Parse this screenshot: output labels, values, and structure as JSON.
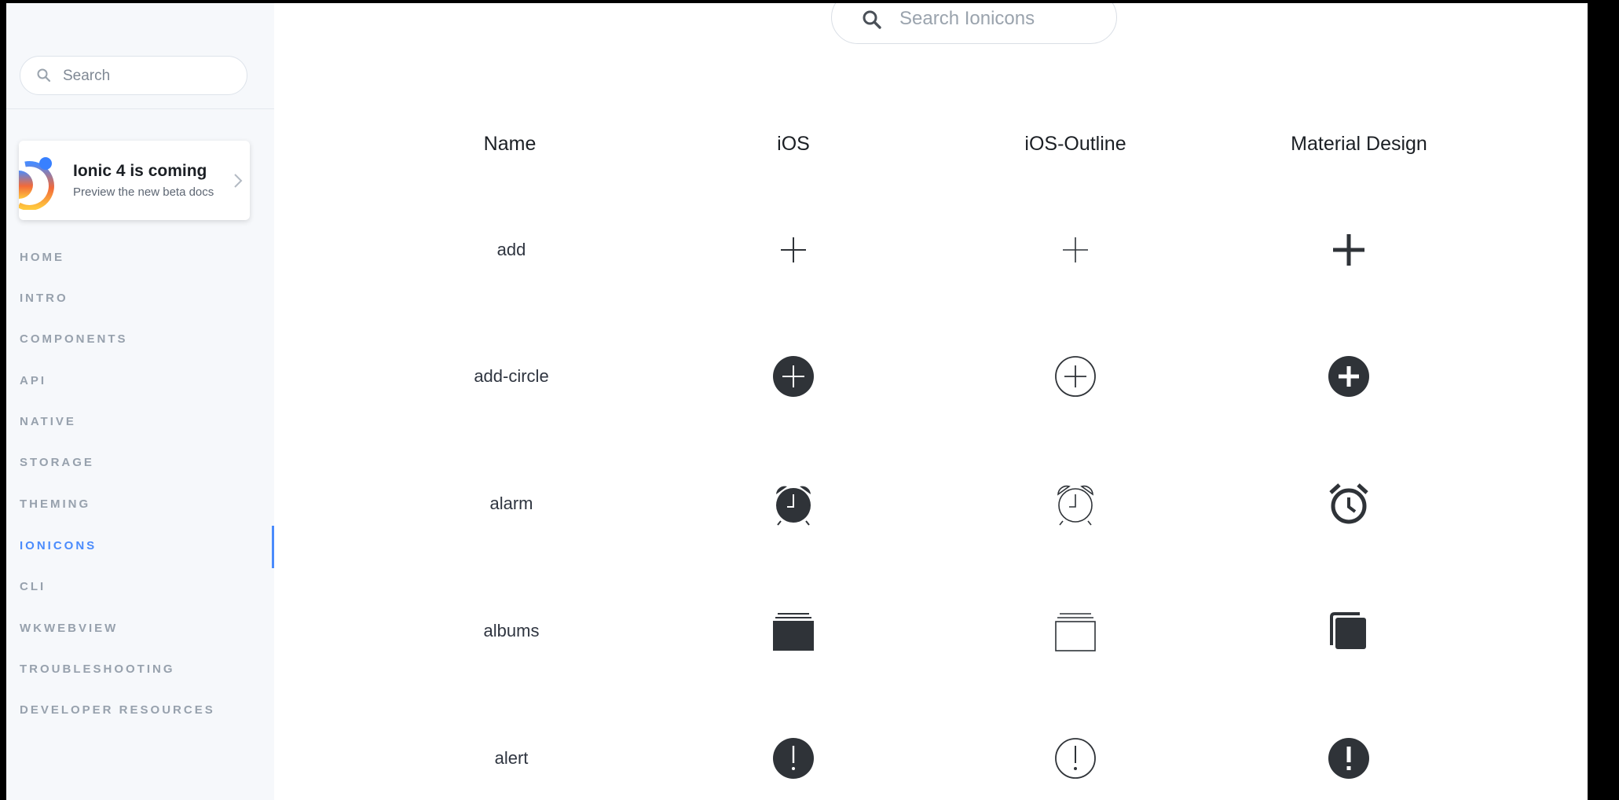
{
  "sidebar": {
    "search_placeholder": "Search",
    "promo": {
      "title": "Ionic 4 is coming",
      "subtitle": "Preview the new beta docs"
    },
    "nav": [
      {
        "label": "HOME",
        "active": false
      },
      {
        "label": "INTRO",
        "active": false
      },
      {
        "label": "COMPONENTS",
        "active": false
      },
      {
        "label": "API",
        "active": false
      },
      {
        "label": "NATIVE",
        "active": false
      },
      {
        "label": "STORAGE",
        "active": false
      },
      {
        "label": "THEMING",
        "active": false
      },
      {
        "label": "IONICONS",
        "active": true
      },
      {
        "label": "CLI",
        "active": false
      },
      {
        "label": "WKWEBVIEW",
        "active": false
      },
      {
        "label": "TROUBLESHOOTING",
        "active": false
      },
      {
        "label": "DEVELOPER RESOURCES",
        "active": false
      }
    ],
    "active_color": "#4a8bfc"
  },
  "main": {
    "search_placeholder": "Search Ionicons",
    "columns": [
      "Name",
      "iOS",
      "iOS-Outline",
      "Material Design"
    ],
    "rows": [
      {
        "name": "add",
        "ios": "add-ios-icon",
        "ios_outline": "add-ios-outline-icon",
        "md": "add-md-icon"
      },
      {
        "name": "add-circle",
        "ios": "add-circle-ios-icon",
        "ios_outline": "add-circle-ios-outline-icon",
        "md": "add-circle-md-icon"
      },
      {
        "name": "alarm",
        "ios": "alarm-ios-icon",
        "ios_outline": "alarm-ios-outline-icon",
        "md": "alarm-md-icon"
      },
      {
        "name": "albums",
        "ios": "albums-ios-icon",
        "ios_outline": "albums-ios-outline-icon",
        "md": "albums-md-icon"
      },
      {
        "name": "alert",
        "ios": "alert-ios-icon",
        "ios_outline": "alert-ios-outline-icon",
        "md": "alert-md-icon"
      }
    ],
    "icon_color": "#2f3338"
  }
}
